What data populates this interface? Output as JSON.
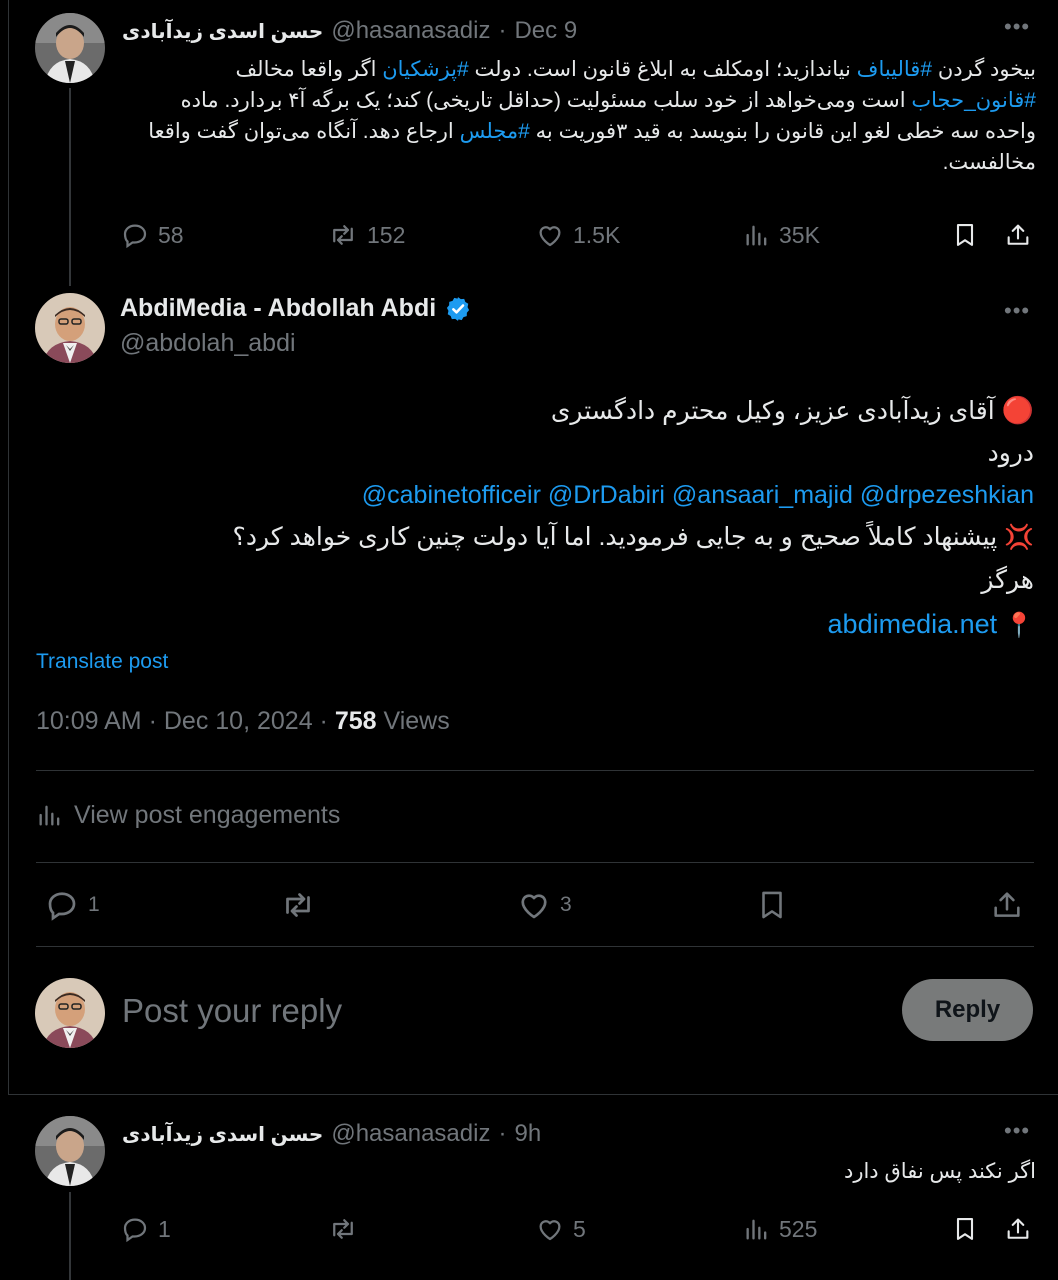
{
  "top_tweet": {
    "display_name": "حسن اسدی زیدآبادی",
    "handle": "@hasanasadiz",
    "date": "Dec 9",
    "text": {
      "l1_a": "بیخود گردن ",
      "l1_tag1": "#قالیباف",
      "l1_b": " نیاندازید؛ اومکلف به ابلاغ قانون است. دولت ",
      "l1_tag2": "#پزشکیان",
      "l1_c": " اگر واقعا مخالف",
      "l2_tag": "#قانون_حجاب",
      "l2_b": " است ومی‌خواهد از خود سلب مسئولیت (حداقل تاریخی) کند؛ یک برگه آ۴ بردارد. ماده",
      "l3_a": "واحده سه خطی لغو این قانون را بنویسد به قید ۳فوریت به ",
      "l3_tag": "#مجلس",
      "l3_b": " ارجاع دهد. آنگاه می‌توان گفت واقعا",
      "l4": "مخالفست."
    },
    "actions": {
      "replies": "58",
      "reposts": "152",
      "likes": "1.5K",
      "views": "35K"
    },
    "icons": [
      "reply-icon",
      "repost-icon",
      "like-icon",
      "views-icon",
      "bookmark-icon",
      "share-icon",
      "more-icon"
    ]
  },
  "main_tweet": {
    "display_name": "AbdiMedia - Abdollah Abdi",
    "handle": "@abdolah_abdi",
    "verified": true,
    "line1_emoji": "🔴",
    "line1": "آقای زیدآبادی عزیز، وکیل محترم دادگستری",
    "line2": "درود",
    "mentions": [
      "@cabinetofficeir",
      "@DrDabiri",
      "@ansaari_majid",
      "@drpezeshkian"
    ],
    "line4_emoji": "💢",
    "line4": "پیشنهاد کاملاً صحیح و به جایی فرمودید. اما آیا دولت چنین کاری خواهد کرد؟",
    "line5": "هرگز",
    "link_emoji": "📍",
    "link": "abdimedia.net",
    "translate": "Translate post",
    "time": "10:09 AM",
    "date": "Dec 10, 2024",
    "views_count": "758",
    "views_label": "Views",
    "engagements": "View post engagements",
    "actions": {
      "replies": "1",
      "reposts": "",
      "likes": "3"
    }
  },
  "reply_box": {
    "placeholder": "Post your reply",
    "button": "Reply"
  },
  "bottom_tweet": {
    "display_name": "حسن اسدی زیدآبادی",
    "handle": "@hasanasadiz",
    "time": "9h",
    "text": "اگر نکند پس نفاق دارد",
    "actions": {
      "replies": "1",
      "reposts": "",
      "likes": "5",
      "views": "525"
    }
  },
  "colors": {
    "background": "#000000",
    "text": "#e7e9ea",
    "muted": "#71767b",
    "accent": "#1d9bf0",
    "divider": "#2f3336",
    "reply_button_bg": "#787a7a"
  },
  "separator": "·"
}
